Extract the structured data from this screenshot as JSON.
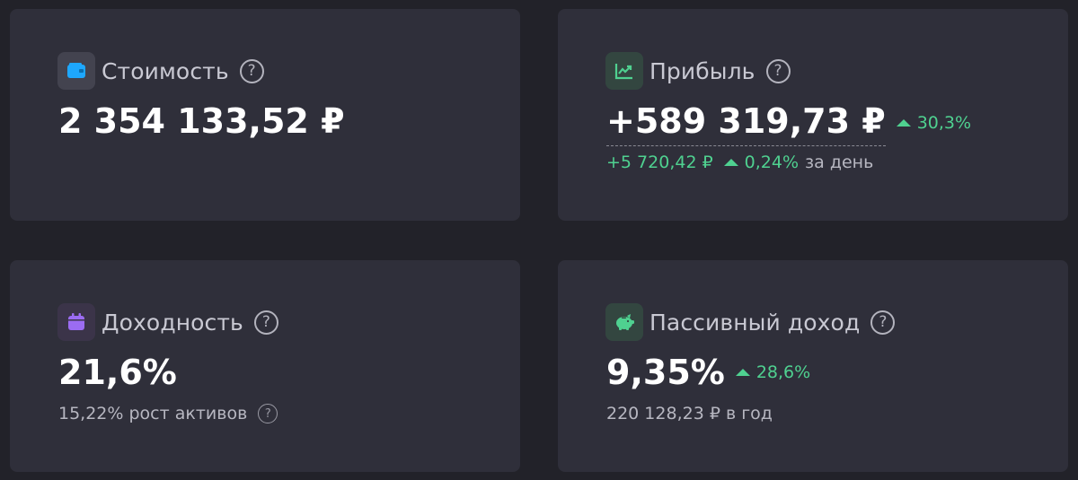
{
  "cards": {
    "value": {
      "title": "Стоимость",
      "amount": "2 354 133,52 ₽",
      "icon": "wallet-icon",
      "icon_color": "#1ea7fd"
    },
    "profit": {
      "title": "Прибыль",
      "amount": "+589 319,73 ₽",
      "change": "30,3%",
      "day_amount": "+5 720,42 ₽",
      "day_change": "0,24%",
      "day_label": "за день",
      "icon": "chart-line-icon",
      "icon_color": "#4fd190"
    },
    "yield": {
      "title": "Доходность",
      "amount": "21,6%",
      "sub_label": "15,22% рост активов",
      "icon": "calendar-icon",
      "icon_color": "#9b6cf2"
    },
    "passive": {
      "title": "Пассивный доход",
      "amount": "9,35%",
      "change": "28,6%",
      "sub_label": "220 128,23 ₽ в год",
      "icon": "piggy-bank-icon",
      "icon_color": "#4fd190"
    }
  },
  "help_symbol": "?",
  "colors": {
    "background": "#222229",
    "card": "#2f2f3a",
    "positive": "#4fd190"
  }
}
